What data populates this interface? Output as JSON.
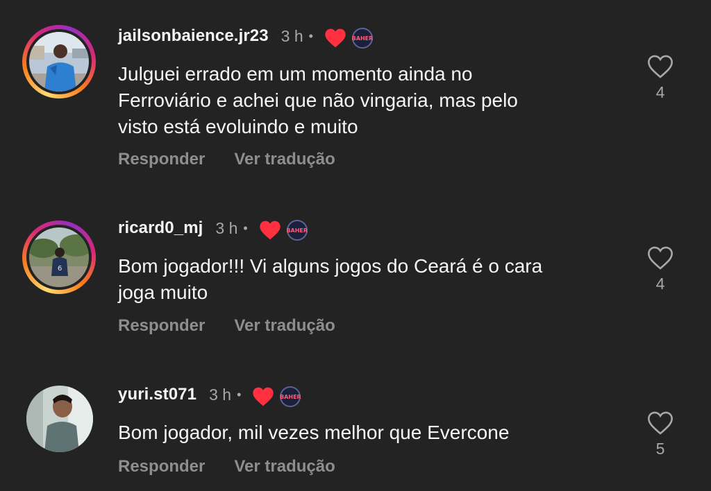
{
  "comments": [
    {
      "username": "jailsonbaience.jr23",
      "time": "3 h",
      "separator": "•",
      "text_lines": [
        "Julguei errado em um momento ainda no",
        "Ferroviário e achei que não vingaria, mas pelo",
        "visto está evoluindo e muito"
      ],
      "reply_label": "Responder",
      "translate_label": "Ver tradução",
      "like_count": "4",
      "has_story_ring": true
    },
    {
      "username": "ricard0_mj",
      "time": "3 h",
      "separator": "•",
      "text_lines": [
        "Bom jogador!!! Vi alguns jogos do Ceará é o cara",
        "joga muito"
      ],
      "reply_label": "Responder",
      "translate_label": "Ver tradução",
      "like_count": "4",
      "has_story_ring": true
    },
    {
      "username": "yuri.st071",
      "time": "3 h",
      "separator": "•",
      "text_lines": [
        "Bom jogador, mil vezes melhor que Evercone"
      ],
      "reply_label": "Responder",
      "translate_label": "Ver tradução",
      "like_count": "5",
      "has_story_ring": false
    }
  ],
  "badge_text": "BAHER",
  "colors": {
    "background": "#232323",
    "text": "#f5f5f5",
    "muted": "#a8a8a8",
    "action": "#8e8e8e",
    "creator_heart": "#ff3040"
  },
  "icons": {
    "creator_like": "red-heart-icon",
    "creator_badge": "creator-avatar-badge",
    "like": "heart-outline-icon"
  }
}
